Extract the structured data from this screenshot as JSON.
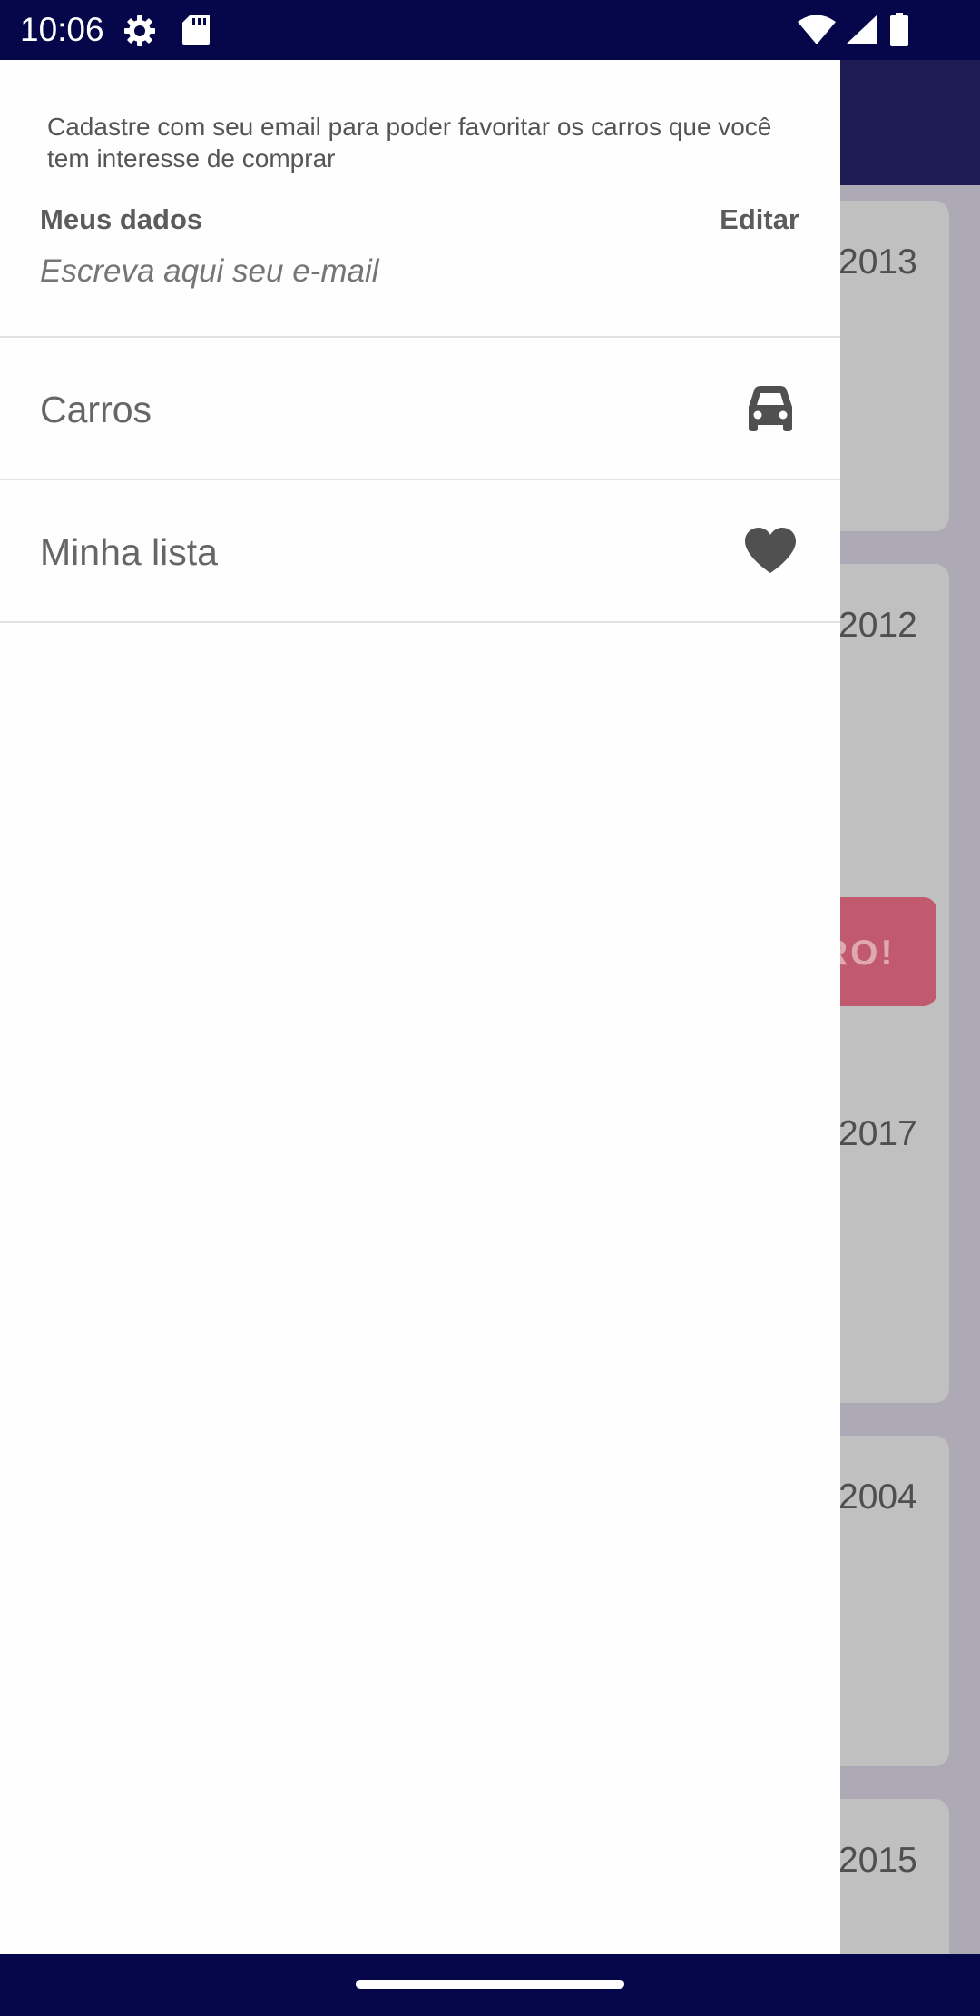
{
  "status_bar": {
    "time": "10:06",
    "icons": [
      "settings-gear-icon",
      "sd-card-icon",
      "wifi-icon",
      "cell-signal-icon",
      "battery-icon"
    ]
  },
  "background_app": {
    "years": [
      "2013",
      "2012",
      "2017",
      "2004",
      "2015"
    ],
    "cta_label_partial": "RO!"
  },
  "drawer": {
    "info_text": "Cadastre com seu email para poder favoritar os carros que você tem interesse de comprar",
    "section_title": "Meus dados",
    "edit_label": "Editar",
    "email_placeholder": "Escreva aqui seu e-mail",
    "email_value": "",
    "menu": [
      {
        "label": "Carros",
        "icon": "car-icon"
      },
      {
        "label": "Minha lista",
        "icon": "heart-icon"
      }
    ]
  },
  "colors": {
    "status_bar": "#06064a",
    "toolbar": "#1e1c53",
    "scrim": "#adaab5",
    "drawer": "#fefefe",
    "cta": "#c1596f"
  }
}
